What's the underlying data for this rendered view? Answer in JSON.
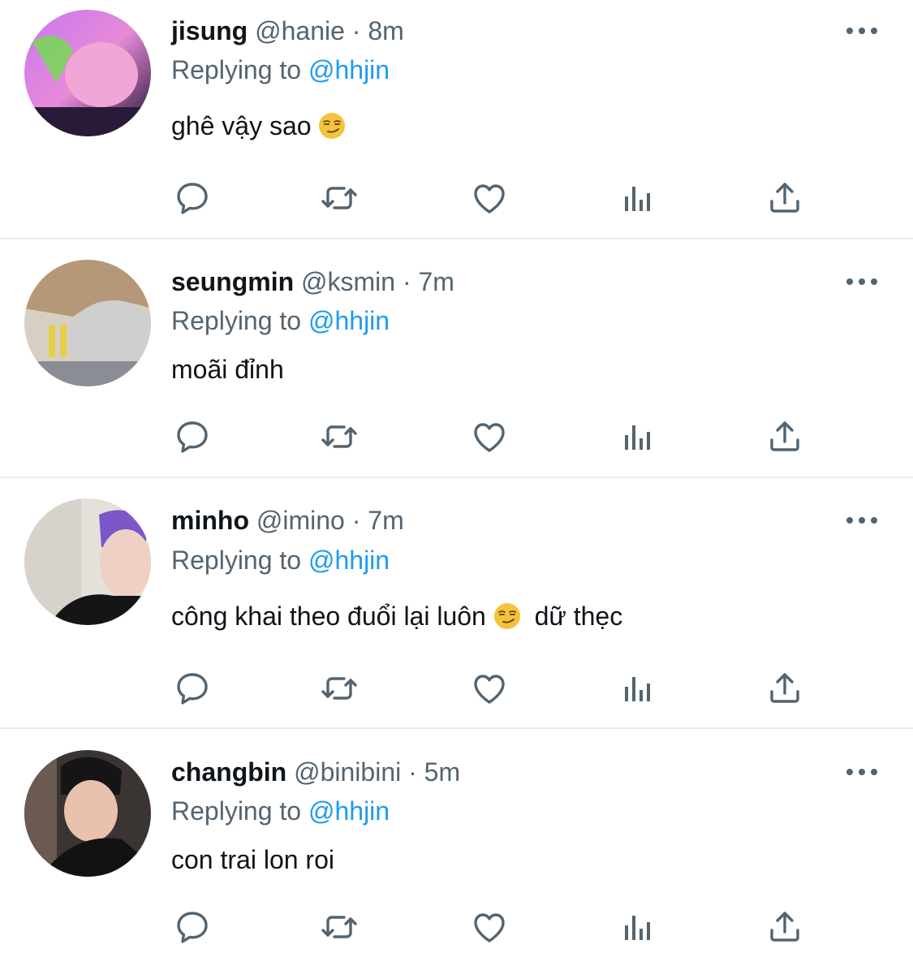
{
  "replying_to_label": "Replying to",
  "tweets": [
    {
      "name": "jisung",
      "handle": "@hanie",
      "sep": "·",
      "time": "8m",
      "mention": "@hhjin",
      "text": "ghê vậy sao",
      "text2": "",
      "emoji": "smirking-face"
    },
    {
      "name": "seungmin",
      "handle": "@ksmin",
      "sep": "·",
      "time": "7m",
      "mention": "@hhjin",
      "text": "moãi đỉnh",
      "text2": "",
      "emoji": ""
    },
    {
      "name": "minho",
      "handle": "@imino",
      "sep": "·",
      "time": "7m",
      "mention": "@hhjin",
      "text": "công khai theo đuổi lại luôn",
      "text2": "dữ thẹc",
      "emoji": "smirking-face"
    },
    {
      "name": "changbin",
      "handle": "@binibini",
      "sep": "·",
      "time": "5m",
      "mention": "@hhjin",
      "text": "con trai lon roi",
      "text2": "",
      "emoji": ""
    }
  ],
  "colors": {
    "accent": "#1d9bf0",
    "secondary_text": "#536471",
    "icon": "#536471",
    "divider": "#e6ecf0"
  },
  "icons": [
    "reply-icon",
    "retweet-icon",
    "like-icon",
    "analytics-icon",
    "share-icon",
    "more-icon"
  ]
}
